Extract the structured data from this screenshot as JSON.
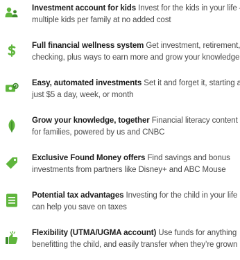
{
  "features": [
    {
      "icon": "family-icon",
      "title": "Investment account for kids",
      "line1_rest": " Invest for the kids in your life —",
      "line2": "multiple kids per family at no added cost"
    },
    {
      "icon": "dollar-sign-icon",
      "title": "Full financial wellness system",
      "line1_rest": " Get investment, retirement,",
      "line2": "checking, plus ways to earn more and grow your knowledge"
    },
    {
      "icon": "recurring-money-icon",
      "title": "Easy, automated investments",
      "line1_rest": " Set it and forget it, starting at",
      "line2": "just $5 a day, week, or month"
    },
    {
      "icon": "sprout-icon",
      "title": "Grow your knowledge, together",
      "line1_rest": " Financial literacy content",
      "line2": "for families, powered by us and CNBC"
    },
    {
      "icon": "tag-icon",
      "title": "Exclusive Found Money offers",
      "line1_rest": " Find savings and bonus",
      "line2": "investments from partners like Disney+ and ABC Mouse"
    },
    {
      "icon": "document-icon",
      "title": "Potential tax advantages",
      "line1_rest": " Investing for the child in your life",
      "line2": "can help you save on taxes"
    },
    {
      "icon": "thumbs-up-icon",
      "title": "Flexibility (UTMA/UGMA account)",
      "line1_rest": " Use funds for anything",
      "line2": "benefitting the child, and easily transfer when they’re grown"
    }
  ],
  "colors": {
    "accent_green": "#5fb53c",
    "accent_green_dark": "#3d8b2a",
    "title_text": "#1c1c1c",
    "body_text": "#4a4a4a"
  }
}
